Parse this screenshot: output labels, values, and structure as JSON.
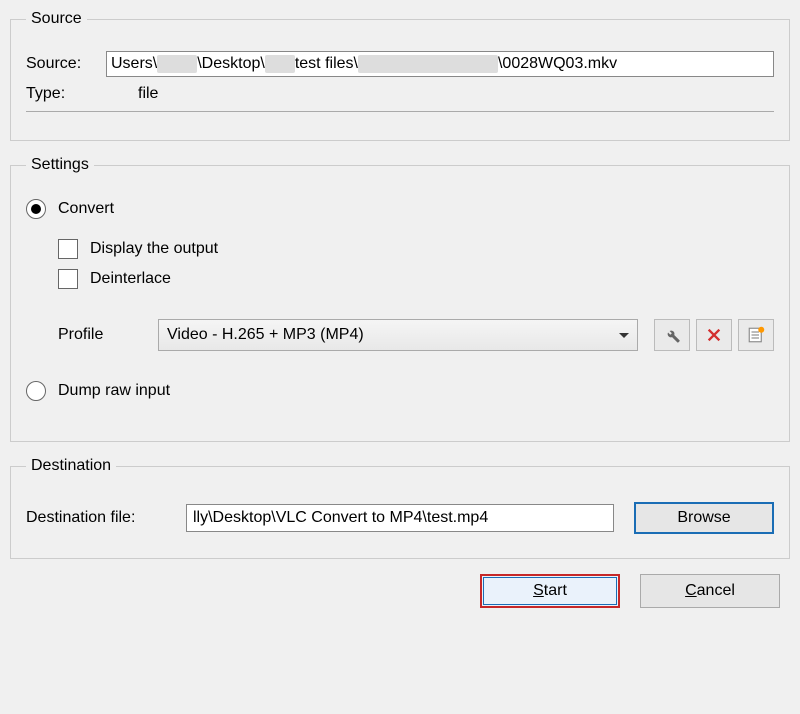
{
  "source": {
    "legend": "Source",
    "source_label": "Source:",
    "source_value_parts": [
      "Users\\",
      "\\Desktop\\",
      "test files\\",
      "\\0028WQ03.mkv"
    ],
    "type_label": "Type:",
    "type_value": "file"
  },
  "settings": {
    "legend": "Settings",
    "convert_label": "Convert",
    "display_output_label": "Display the output",
    "deinterlace_label": "Deinterlace",
    "profile_label": "Profile",
    "profile_value": "Video - H.265 + MP3 (MP4)",
    "dump_label": "Dump raw input",
    "icons": {
      "edit": "wrench-icon",
      "delete": "delete-icon",
      "new": "new-profile-icon"
    }
  },
  "destination": {
    "legend": "Destination",
    "file_label": "Destination file:",
    "file_value": "lly\\Desktop\\VLC Convert to MP4\\test.mp4",
    "browse_label": "Browse"
  },
  "buttons": {
    "start": "Start",
    "cancel": "Cancel"
  }
}
